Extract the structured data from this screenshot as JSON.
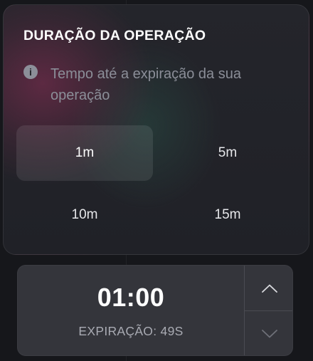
{
  "duration_panel": {
    "title": "DURAÇÃO DA OPERAÇÃO",
    "info_text": "Tempo até a expiração da sua operação",
    "info_icon_glyph": "i",
    "options": [
      {
        "label": "1m",
        "selected": true
      },
      {
        "label": "5m",
        "selected": false
      },
      {
        "label": "10m",
        "selected": false
      },
      {
        "label": "15m",
        "selected": false
      }
    ]
  },
  "timer": {
    "value": "01:00",
    "expiry_text": "EXPIRAÇÃO: 49S",
    "up_icon": "chevron-up-icon",
    "down_icon": "chevron-down-icon"
  },
  "colors": {
    "background": "#16171b",
    "panel": "#24252b",
    "timer_box": "#34353b",
    "muted_text": "#8b8e98",
    "accent_glow": "#8c2e56"
  }
}
